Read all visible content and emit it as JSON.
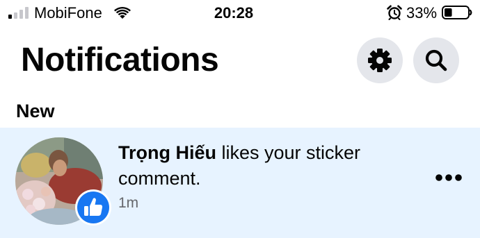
{
  "status_bar": {
    "carrier": "MobiFone",
    "time": "20:28",
    "battery_percent": "33%",
    "battery_level": 0.33,
    "icons": [
      "signal-icon",
      "wifi-icon",
      "alarm-icon",
      "battery-icon"
    ]
  },
  "header": {
    "title": "Notifications",
    "settings_icon": "gear-icon",
    "search_icon": "search-icon"
  },
  "sections": {
    "new_label": "New"
  },
  "notification": {
    "actor": "Trọng Hiếu",
    "message": " likes your sticker comment.",
    "time": "1m",
    "reaction_icon": "thumbs-up-icon",
    "more_icon": "more-dots-icon",
    "unread": true
  },
  "colors": {
    "unread_background": "#e7f3ff",
    "button_background": "#e4e6eb",
    "like_blue": "#1877f2",
    "secondary_text": "#65676b"
  }
}
